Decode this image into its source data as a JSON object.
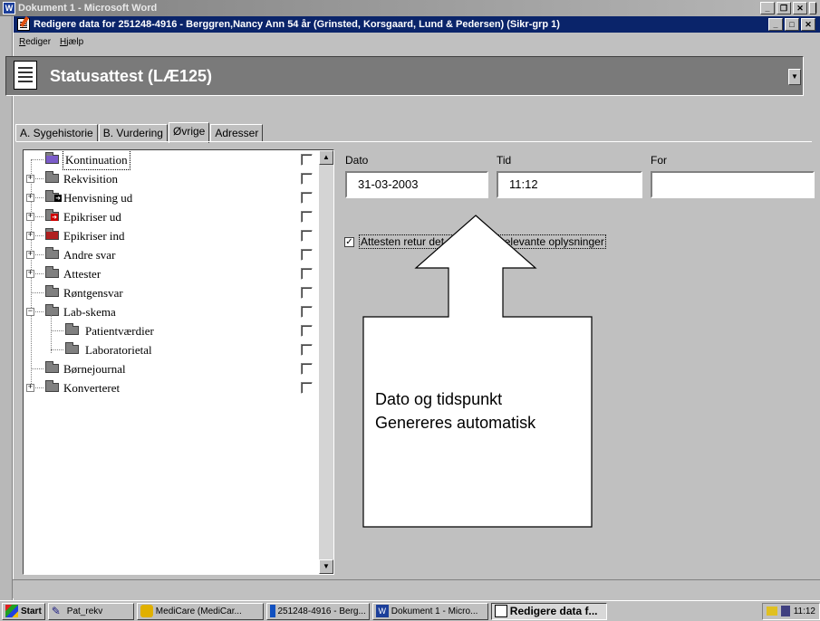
{
  "outer_window": {
    "title": "Dokument 1 - Microsoft Word"
  },
  "inner_window": {
    "title": "Redigere data for 251248-4916 - Berggren,Nancy Ann  54 år  (Grinsted, Korsgaard, Lund & Pedersen)  (Sikr-grp 1)",
    "menu": [
      "Rediger",
      "Hjælp"
    ]
  },
  "header": {
    "title": "Statusattest (LÆ125)"
  },
  "tabs": [
    "A. Sygehistorie",
    "B. Vurdering",
    "Øvrige",
    "Adresser"
  ],
  "active_tab": "Øvrige",
  "tree": {
    "items": [
      {
        "label": "Kontinuation"
      },
      {
        "label": "Rekvisition"
      },
      {
        "label": "Henvisning ud"
      },
      {
        "label": "Epikriser ud"
      },
      {
        "label": "Epikriser ind"
      },
      {
        "label": "Andre svar"
      },
      {
        "label": "Attester"
      },
      {
        "label": "Røntgensvar"
      },
      {
        "label": "Lab-skema"
      },
      {
        "label": "Patientværdier"
      },
      {
        "label": "Laboratorietal"
      },
      {
        "label": "Børnejournal"
      },
      {
        "label": "Konverteret"
      }
    ]
  },
  "fields": {
    "dato": {
      "label": "Dato",
      "value": "31-03-2003"
    },
    "tid": {
      "label": "Tid",
      "value": "11:12"
    },
    "for": {
      "label": "For",
      "value": ""
    }
  },
  "checkbox": {
    "label": "Attesten retur      det mangel på relevante oplysninger",
    "checked": true
  },
  "annotation": {
    "line1": "Dato og tidspunkt",
    "line2": "Genereres automatisk"
  },
  "taskbar": {
    "start": "Start",
    "tasks": [
      "Pat_rekv",
      "MediCare (MediCar...",
      "251248-4916 - Berg...",
      "Dokument 1 - Micro...",
      "Redigere data f..."
    ],
    "clock": "11:12"
  },
  "colors": {
    "title_active": "#0a246a",
    "header_panel": "#7a7a7a",
    "face": "#c0c0c0"
  }
}
